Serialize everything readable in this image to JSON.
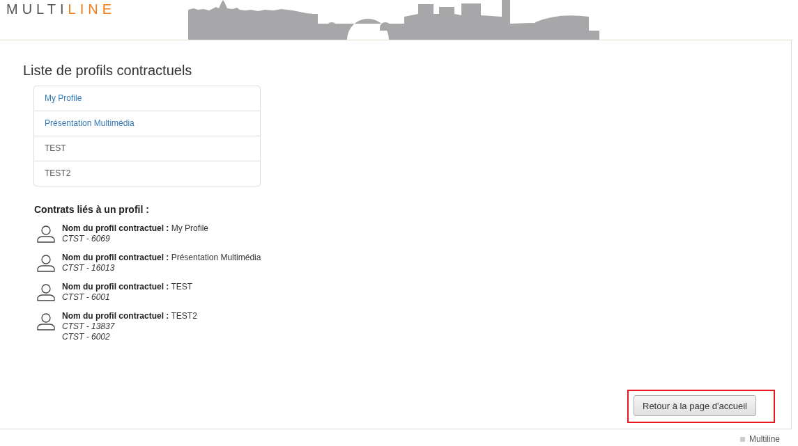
{
  "logo": {
    "first": "MULTI",
    "second": "LINE"
  },
  "title": "Liste de profils contractuels",
  "profiles": [
    "My Profile",
    "Présentation Multimédia",
    "TEST",
    "TEST2"
  ],
  "contracts_heading": "Contrats liés à un profil :",
  "contracts": [
    {
      "label": "Nom du profil contractuel :",
      "name": "My Profile",
      "codes": [
        "CTST - 6069"
      ]
    },
    {
      "label": "Nom du profil contractuel :",
      "name": "Présentation Multimédia",
      "codes": [
        "CTST - 16013"
      ]
    },
    {
      "label": "Nom du profil contractuel :",
      "name": "TEST",
      "codes": [
        "CTST - 6001"
      ]
    },
    {
      "label": "Nom du profil contractuel :",
      "name": "TEST2",
      "codes": [
        "CTST - 13837",
        "CTST - 6002"
      ]
    }
  ],
  "home_button": "Retour à la page d'accueil",
  "footer": "Multiline"
}
